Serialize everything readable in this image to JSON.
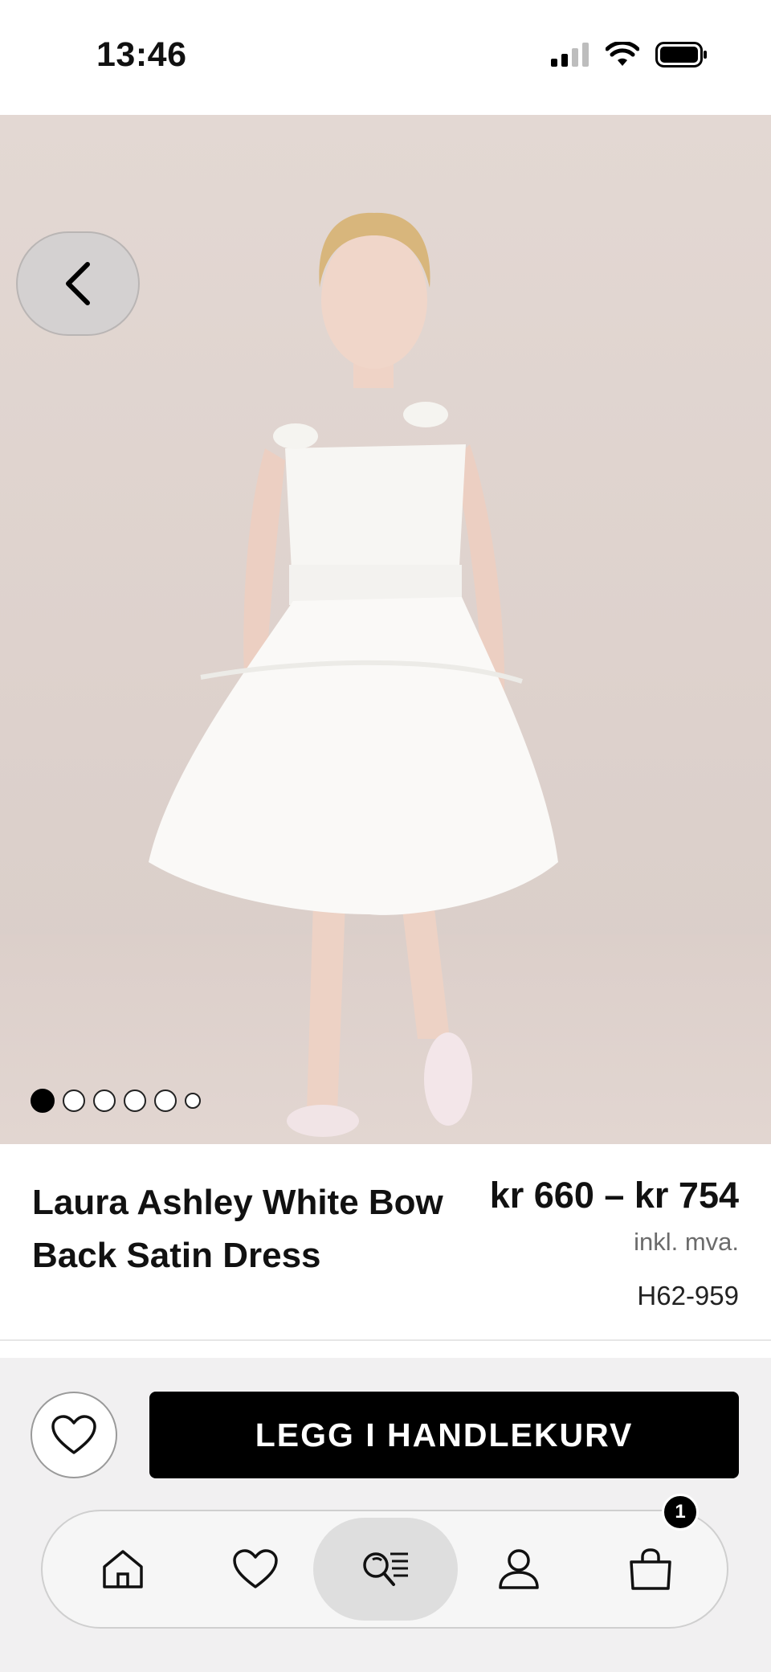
{
  "status_bar": {
    "time": "13:46",
    "icons": [
      "signal-icon",
      "wifi-icon",
      "battery-icon"
    ]
  },
  "hero": {
    "image": "product-photo",
    "carousel": {
      "total": 6,
      "active": 1
    },
    "back_icon": "chevron-left-icon"
  },
  "product": {
    "name": "Laura Ashley White Bow Back Satin Dress",
    "price": "kr 660 – kr 754",
    "vat_note": "inkl. mva.",
    "sku": "H62-959"
  },
  "actions": {
    "favorite_icon": "heart-icon",
    "add_to_cart_label": "LEGG I HANDLEKURV"
  },
  "tabbar": {
    "items": [
      {
        "id": "home",
        "icon": "home-icon"
      },
      {
        "id": "favorites",
        "icon": "heart-icon"
      },
      {
        "id": "search",
        "icon": "search-list-icon",
        "active": true
      },
      {
        "id": "account",
        "icon": "user-icon"
      },
      {
        "id": "bag",
        "icon": "shopping-bag-icon",
        "badge": "1"
      }
    ]
  },
  "colors": {
    "accent": "#000000",
    "background": "#ffffff",
    "action_area": "#f1f0f1",
    "muted_text": "#6b6b6b"
  }
}
